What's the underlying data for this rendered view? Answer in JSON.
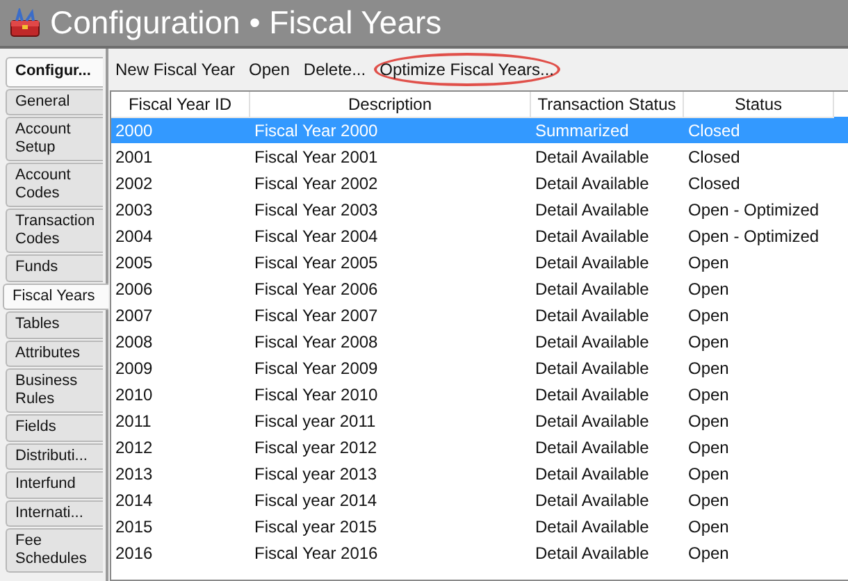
{
  "window": {
    "title": "Configuration • Fiscal Years"
  },
  "sidebar": {
    "tabs": [
      {
        "label": "Configur...",
        "kind": "header",
        "selected": false
      },
      {
        "label": "General",
        "kind": "tab",
        "selected": false
      },
      {
        "label": "Account Setup",
        "kind": "tab",
        "selected": false
      },
      {
        "label": "Account Codes",
        "kind": "tab",
        "selected": false
      },
      {
        "label": "Transaction Codes",
        "kind": "tab",
        "selected": false
      },
      {
        "label": "Funds",
        "kind": "tab",
        "selected": false
      },
      {
        "label": "Fiscal Years",
        "kind": "tab",
        "selected": true
      },
      {
        "label": "Tables",
        "kind": "tab",
        "selected": false
      },
      {
        "label": "Attributes",
        "kind": "tab",
        "selected": false
      },
      {
        "label": "Business Rules",
        "kind": "tab",
        "selected": false
      },
      {
        "label": "Fields",
        "kind": "tab",
        "selected": false
      },
      {
        "label": "Distributi...",
        "kind": "tab",
        "selected": false
      },
      {
        "label": "Interfund",
        "kind": "tab",
        "selected": false
      },
      {
        "label": "Internati...",
        "kind": "tab",
        "selected": false
      },
      {
        "label": "Fee Schedules",
        "kind": "tab",
        "selected": false
      }
    ]
  },
  "toolbar": [
    {
      "label": "New Fiscal Year",
      "highlighted": false
    },
    {
      "label": "Open",
      "highlighted": false
    },
    {
      "label": "Delete...",
      "highlighted": false
    },
    {
      "label": "Optimize Fiscal Years...",
      "highlighted": true
    }
  ],
  "table": {
    "columns": [
      "Fiscal Year ID",
      "Description",
      "Transaction Status",
      "Status"
    ],
    "rows": [
      {
        "cells": [
          "2000",
          "Fiscal Year 2000",
          "Summarized",
          "Closed"
        ],
        "selected": true
      },
      {
        "cells": [
          "2001",
          "Fiscal Year 2001",
          "Detail Available",
          "Closed"
        ],
        "selected": false
      },
      {
        "cells": [
          "2002",
          "Fiscal Year 2002",
          "Detail Available",
          "Closed"
        ],
        "selected": false
      },
      {
        "cells": [
          "2003",
          "Fiscal Year 2003",
          "Detail Available",
          "Open - Optimized"
        ],
        "selected": false
      },
      {
        "cells": [
          "2004",
          "Fiscal Year 2004",
          "Detail Available",
          "Open - Optimized"
        ],
        "selected": false
      },
      {
        "cells": [
          "2005",
          "Fiscal Year 2005",
          "Detail Available",
          "Open"
        ],
        "selected": false
      },
      {
        "cells": [
          "2006",
          "Fiscal Year 2006",
          "Detail Available",
          "Open"
        ],
        "selected": false
      },
      {
        "cells": [
          "2007",
          "Fiscal Year 2007",
          "Detail Available",
          "Open"
        ],
        "selected": false
      },
      {
        "cells": [
          "2008",
          "Fiscal Year 2008",
          "Detail Available",
          "Open"
        ],
        "selected": false
      },
      {
        "cells": [
          "2009",
          "Fiscal Year 2009",
          "Detail Available",
          "Open"
        ],
        "selected": false
      },
      {
        "cells": [
          "2010",
          "Fiscal Year 2010",
          "Detail Available",
          "Open"
        ],
        "selected": false
      },
      {
        "cells": [
          "2011",
          "Fiscal year 2011",
          "Detail Available",
          "Open"
        ],
        "selected": false
      },
      {
        "cells": [
          "2012",
          "Fiscal year 2012",
          "Detail Available",
          "Open"
        ],
        "selected": false
      },
      {
        "cells": [
          "2013",
          "Fiscal year 2013",
          "Detail Available",
          "Open"
        ],
        "selected": false
      },
      {
        "cells": [
          "2014",
          "Fiscal year 2014",
          "Detail Available",
          "Open"
        ],
        "selected": false
      },
      {
        "cells": [
          "2015",
          "Fiscal year 2015",
          "Detail Available",
          "Open"
        ],
        "selected": false
      },
      {
        "cells": [
          "2016",
          "Fiscal Year 2016",
          "Detail Available",
          "Open"
        ],
        "selected": false
      }
    ]
  }
}
